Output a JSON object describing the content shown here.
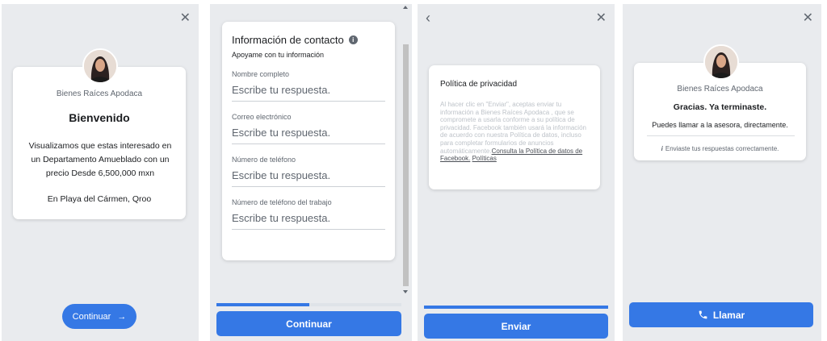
{
  "panel1": {
    "company": "Bienes Raíces Apodaca",
    "title": "Bienvenido",
    "description": "Visualizamos que estas interesado en un Departamento Amueblado con un precio Desde 6,500,000 mxn",
    "location": "En Playa del Cármen, Qroo",
    "button_label": "Continuar",
    "button_arrow": "→",
    "close_glyph": "✕"
  },
  "panel2": {
    "section_title": "Información de contacto",
    "subtitle": "Apoyame con tu información",
    "fields": [
      {
        "label": "Nombre completo",
        "placeholder": "Escribe tu respuesta."
      },
      {
        "label": "Correo electrónico",
        "placeholder": "Escribe tu respuesta."
      },
      {
        "label": "Número de teléfono",
        "placeholder": "Escribe tu respuesta."
      },
      {
        "label": "Número de teléfono del trabajo",
        "placeholder": "Escribe tu respuesta."
      }
    ],
    "progress": 0.5,
    "button_label": "Continuar"
  },
  "panel3": {
    "back_glyph": "‹",
    "close_glyph": "✕",
    "title": "Política de privacidad",
    "body": "Al hacer clic en \"Enviar\", aceptas enviar tu información a Bienes Raíces Apodaca , que se compromete a usarla conforme a su política de privacidad. Facebook también usará la información de acuerdo con nuestra Política de datos, incluso para completar formularios de anuncios automáticamente.",
    "link1": "Consulta la Política de datos de Facebook.",
    "link2": "Políticas",
    "progress": 1.0,
    "button_label": "Enviar"
  },
  "panel4": {
    "close_glyph": "✕",
    "company": "Bienes Raíces Apodaca",
    "heading": "Gracias. Ya terminaste.",
    "message": "Puedes llamar a la asesora, directamente.",
    "info_glyph": "i",
    "info_text": "Enviaste tus respuestas correctamente.",
    "button_label": "Llamar"
  },
  "colors": {
    "accent": "#3578e5",
    "panel_bg": "#e9ebee",
    "track": "#dfe3e8"
  }
}
